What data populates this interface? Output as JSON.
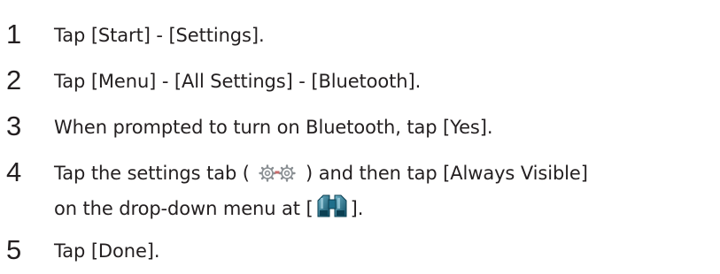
{
  "steps": [
    {
      "number": "1",
      "text": "Tap [Start] - [Settings]."
    },
    {
      "number": "2",
      "text": "Tap [Menu] - [All Settings] - [Bluetooth]."
    },
    {
      "number": "3",
      "text": "When prompted to turn on Bluetooth, tap [Yes]."
    },
    {
      "number": "4",
      "line1_before": "Tap the settings tab ( ",
      "icon1": "settings-tab-gears-icon",
      "line1_after": " ) and then tap [Always Visible]",
      "line2_before": "on the drop-down menu at [",
      "icon2": "binoculars-icon",
      "line2_after": "]."
    },
    {
      "number": "5",
      "text": "Tap [Done]."
    }
  ],
  "colors": {
    "text": "#231f20",
    "binoculars": "#1f6f8b"
  }
}
